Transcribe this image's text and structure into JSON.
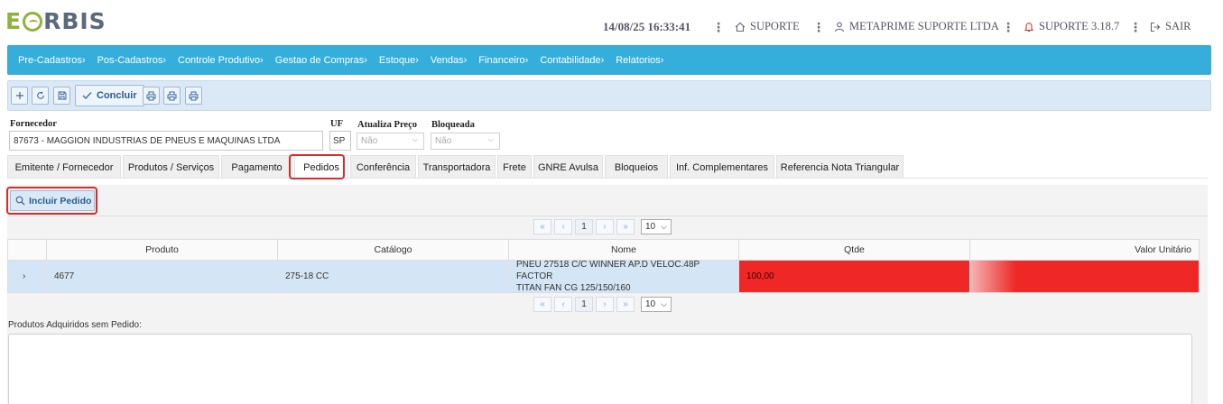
{
  "brand": {
    "logo_e": "E",
    "logo_rest": "RBIS"
  },
  "header": {
    "datetime": "14/08/25 16:33:41",
    "support": "SUPORTE",
    "company": "METAPRIME SUPORTE LTDA",
    "version": "SUPORTE 3.18.7",
    "logout": "SAIR"
  },
  "menu": [
    "Pre-Cadastros›",
    "Pos-Cadastros›",
    "Controle Produtivo›",
    "Gestao de Compras›",
    "Estoque›",
    "Vendas›",
    "Financeiro›",
    "Contabilidade›",
    "Relatorios›"
  ],
  "toolbar": {
    "concluir_label": "Concluir"
  },
  "form": {
    "fornecedor_label": "Fornecedor",
    "fornecedor_value": "87673 - MAGGION INDUSTRIAS DE PNEUS E MAQUINAS LTDA",
    "uf_label": "UF",
    "uf_value": "SP",
    "atualiza_label": "Atualiza Preço",
    "atualiza_value": "Não",
    "bloqueada_label": "Bloqueada",
    "bloqueada_value": "Não"
  },
  "tabs": [
    "Emitente / Fornecedor",
    "Produtos / Serviços",
    "Pagamento",
    "Pedidos",
    "Conferência",
    "Transportadora",
    "Frete",
    "GNRE Avulsa",
    "Bloqueios",
    "Inf. Complementares",
    "Referencia Nota Triangular"
  ],
  "active_tab": "Pedidos",
  "content": {
    "incluir_label": "Incluir Pedido",
    "produtos_sem_pedido_label": "Produtos Adquiridos sem Pedido:"
  },
  "pager": {
    "first": "«",
    "prev": "‹",
    "page": "1",
    "next": "›",
    "last": "»",
    "page_size": "10"
  },
  "table": {
    "columns": [
      "",
      "Produto",
      "Catálogo",
      "Nome",
      "Qtde",
      "Valor Unitário"
    ],
    "rows": [
      {
        "expand": "›",
        "produto": "4677",
        "catalogo": "275-18 CC",
        "nome_line1": "PNEU 27518 C/C WINNER AP.D VELOC.48P FACTOR",
        "nome_line2": "TITAN FAN CG 125/150/160",
        "qtde": "100,00",
        "valor_unitario": ""
      }
    ]
  },
  "colors": {
    "menubar": "#35aedc",
    "highlight": "#d92b2b",
    "qtde_cell": "#f02727",
    "row_selected": "#d4e6f5"
  },
  "icons": [
    "plus-icon",
    "refresh-icon",
    "save-icon",
    "check-icon",
    "print-icon",
    "home-icon",
    "user-icon",
    "bell-icon",
    "logout-icon",
    "search-icon"
  ]
}
